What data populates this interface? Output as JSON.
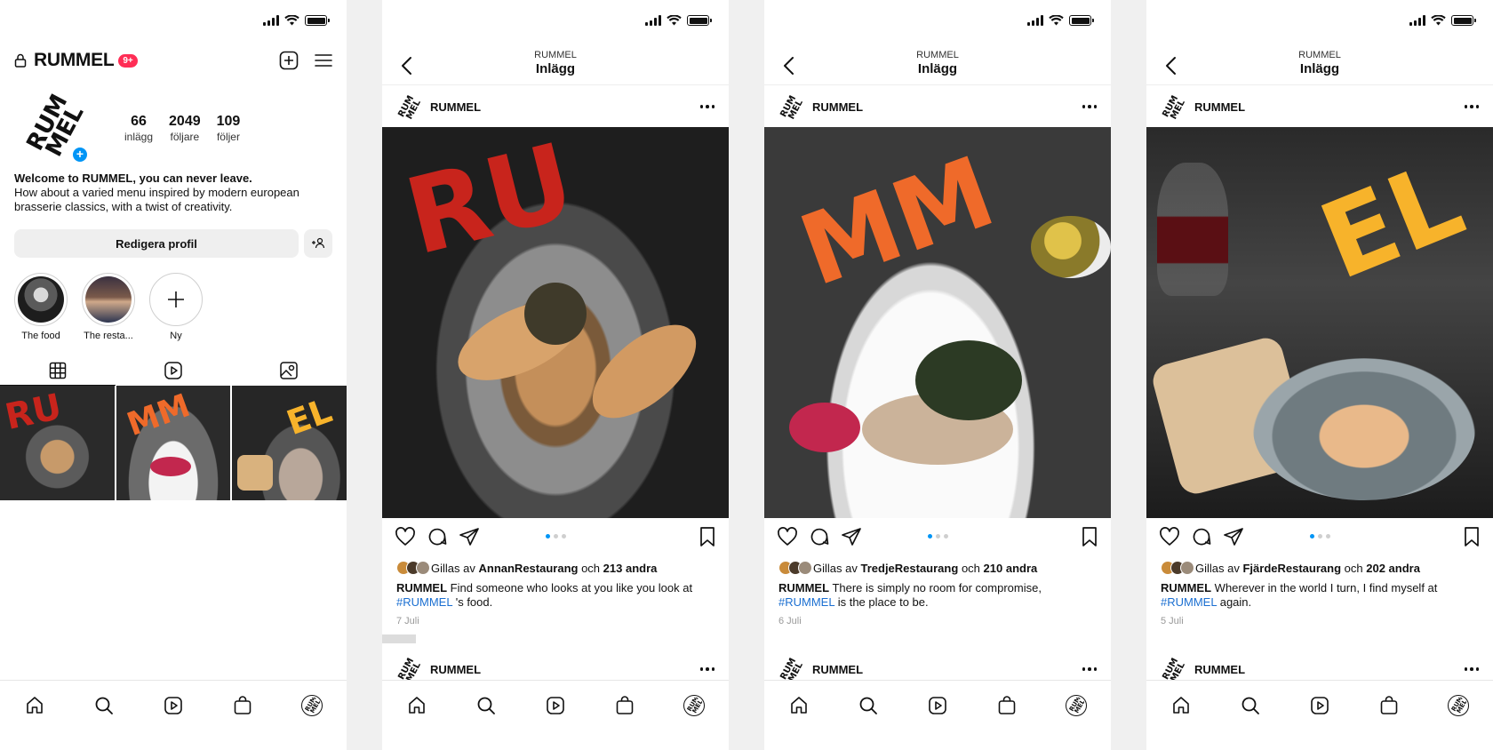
{
  "status": {
    "signal": "signal-icon",
    "wifi": "wifi-icon",
    "battery": "battery-icon"
  },
  "profile": {
    "username": "RUMMEL",
    "notification_badge": "9+",
    "stats": [
      {
        "value": "66",
        "label": "inlägg"
      },
      {
        "value": "2049",
        "label": "följare"
      },
      {
        "value": "109",
        "label": "följer"
      }
    ],
    "bio_title": "Welcome to RUMMEL, you can never leave.",
    "bio_text": "How about a varied menu inspired by modern european brasserie classics, with a twist of creativity.",
    "edit_button": "Redigera profil",
    "highlights": [
      {
        "label": "The food"
      },
      {
        "label": "The resta..."
      },
      {
        "label": "Ny"
      }
    ],
    "grid_overlays": [
      "RU",
      "MM",
      "EL"
    ]
  },
  "post_screen": {
    "account": "RUMMEL",
    "title": "Inlägg"
  },
  "posts": [
    {
      "author": "RUMMEL",
      "overlay": "RU",
      "liked_by_prefix": "Gillas av",
      "liked_by_user": "AnnanRestaurang",
      "liked_by_and": "och",
      "liked_by_others": "213 andra",
      "caption_user": "RUMMEL",
      "caption_before": "Find someone who looks at you like you look at",
      "hashtag": "#RUMMEL",
      "caption_after": "'s food.",
      "date": "7 Juli"
    },
    {
      "author": "RUMMEL",
      "overlay": "MM",
      "liked_by_prefix": "Gillas av",
      "liked_by_user": "TredjeRestaurang",
      "liked_by_and": "och",
      "liked_by_others": "210 andra",
      "caption_user": "RUMMEL",
      "caption_before": "There is simply no room for compromise,",
      "hashtag": "#RUMMEL",
      "caption_after": "is the place to be.",
      "date": "6 Juli"
    },
    {
      "author": "RUMMEL",
      "overlay": "EL",
      "liked_by_prefix": "Gillas av",
      "liked_by_user": "FjärdeRestaurang",
      "liked_by_and": "och",
      "liked_by_others": "202 andra",
      "caption_user": "RUMMEL",
      "caption_before": "Wherever in the world I turn, I find myself at",
      "hashtag": "#RUMMEL",
      "caption_after": "again.",
      "date": "5 Juli"
    }
  ],
  "next_post": {
    "author": "RUMMEL"
  },
  "tabbar": [
    "home-icon",
    "search-icon",
    "reels-icon",
    "shop-icon",
    "profile-avatar"
  ],
  "colors": {
    "accent": "#0095f6",
    "badge": "#ff2d55",
    "hashtag": "#1b6fd1",
    "ru": "#c8241c",
    "mm": "#ef6a2a",
    "el": "#f7b32b"
  }
}
